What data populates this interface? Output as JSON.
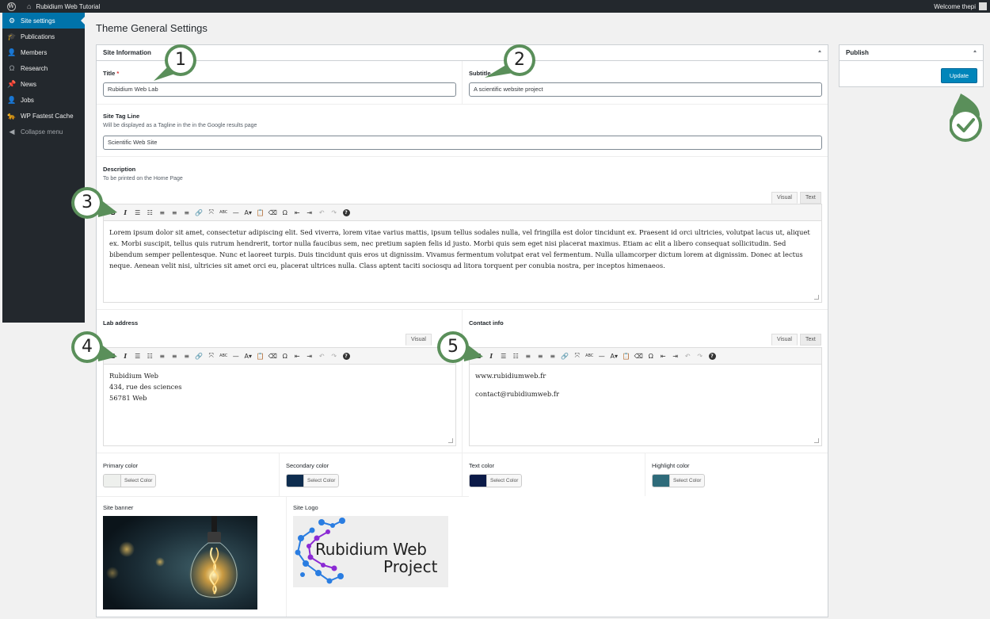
{
  "adminbar": {
    "site_name": "Rubidium Web Tutorial",
    "welcome": "Welcome thepi"
  },
  "sidebar": {
    "items": [
      {
        "label": "Site settings",
        "icon": "gear-icon"
      },
      {
        "label": "Publications",
        "icon": "graduation-cap-icon"
      },
      {
        "label": "Members",
        "icon": "person-icon"
      },
      {
        "label": "Research",
        "icon": "omega-icon"
      },
      {
        "label": "News",
        "icon": "pin-icon"
      },
      {
        "label": "Jobs",
        "icon": "person-icon"
      },
      {
        "label": "WP Fastest Cache",
        "icon": "cheetah-icon"
      },
      {
        "label": "Collapse menu",
        "icon": "collapse-icon"
      }
    ]
  },
  "page_title": "Theme General Settings",
  "site_info": {
    "header": "Site Information",
    "title_label": "Title",
    "title_required": "*",
    "title_value": "Rubidium Web Lab",
    "subtitle_label": "Subtitle",
    "subtitle_value": "A scientific website project",
    "tagline_label": "Site Tag Line",
    "tagline_desc": "Will be displayed as a Tagline in the in the Google results page",
    "tagline_value": "Scientific Web Site",
    "description_label": "Description",
    "description_desc": "To be printed on the Home Page",
    "description_text": "Lorem ipsum dolor sit amet, consectetur adipiscing elit. Sed viverra, lorem vitae varius mattis, ipsum tellus sodales nulla, vel fringilla est dolor tincidunt ex. Praesent id orci ultricies, volutpat lacus ut, aliquet ex. Morbi suscipit, tellus quis rutrum hendrerit, tortor nulla faucibus sem, nec pretium sapien felis id justo. Morbi quis sem eget nisi placerat maximus. Etiam ac elit a libero consequat sollicitudin. Sed bibendum semper pellentesque. Nunc et laoreet turpis. Duis tincidunt quis eros ut dignissim. Vivamus fermentum volutpat erat vel fermentum. Nulla ullamcorper dictum lorem at dignissim. Donec at lectus neque. Aenean velit nisi, ultricies sit amet orci eu, placerat ultrices nulla. Class aptent taciti sociosqu ad litora torquent per conubia nostra, per inceptos himenaeos.",
    "lab_address_label": "Lab address",
    "lab_address_lines": [
      "Rubidium Web",
      "434, rue des sciences",
      "56781 Web"
    ],
    "contact_label": "Contact info",
    "contact_lines": [
      "www.rubidiumweb.fr",
      "contact@rubidiumweb.fr"
    ],
    "primary_color_label": "Primary color",
    "secondary_color_label": "Secondary color",
    "text_color_label": "Text color",
    "highlight_color_label": "Highlight color",
    "select_color": "Select Color",
    "banner_label": "Site banner",
    "logo_label": "Site Logo",
    "logo_text_1": "Rubidium Web",
    "logo_text_2": "Project"
  },
  "editor": {
    "visual_tab": "Visual",
    "text_tab": "Text"
  },
  "colors": {
    "primary": "#eef0ed",
    "secondary": "#0e2d4f",
    "text": "#0b1a48",
    "highlight": "#2e6b7a",
    "accent": "#0073aa",
    "callout": "#5a8f5a"
  },
  "publish": {
    "header": "Publish",
    "update_label": "Update"
  },
  "callouts": [
    "1",
    "2",
    "3",
    "4",
    "5"
  ]
}
